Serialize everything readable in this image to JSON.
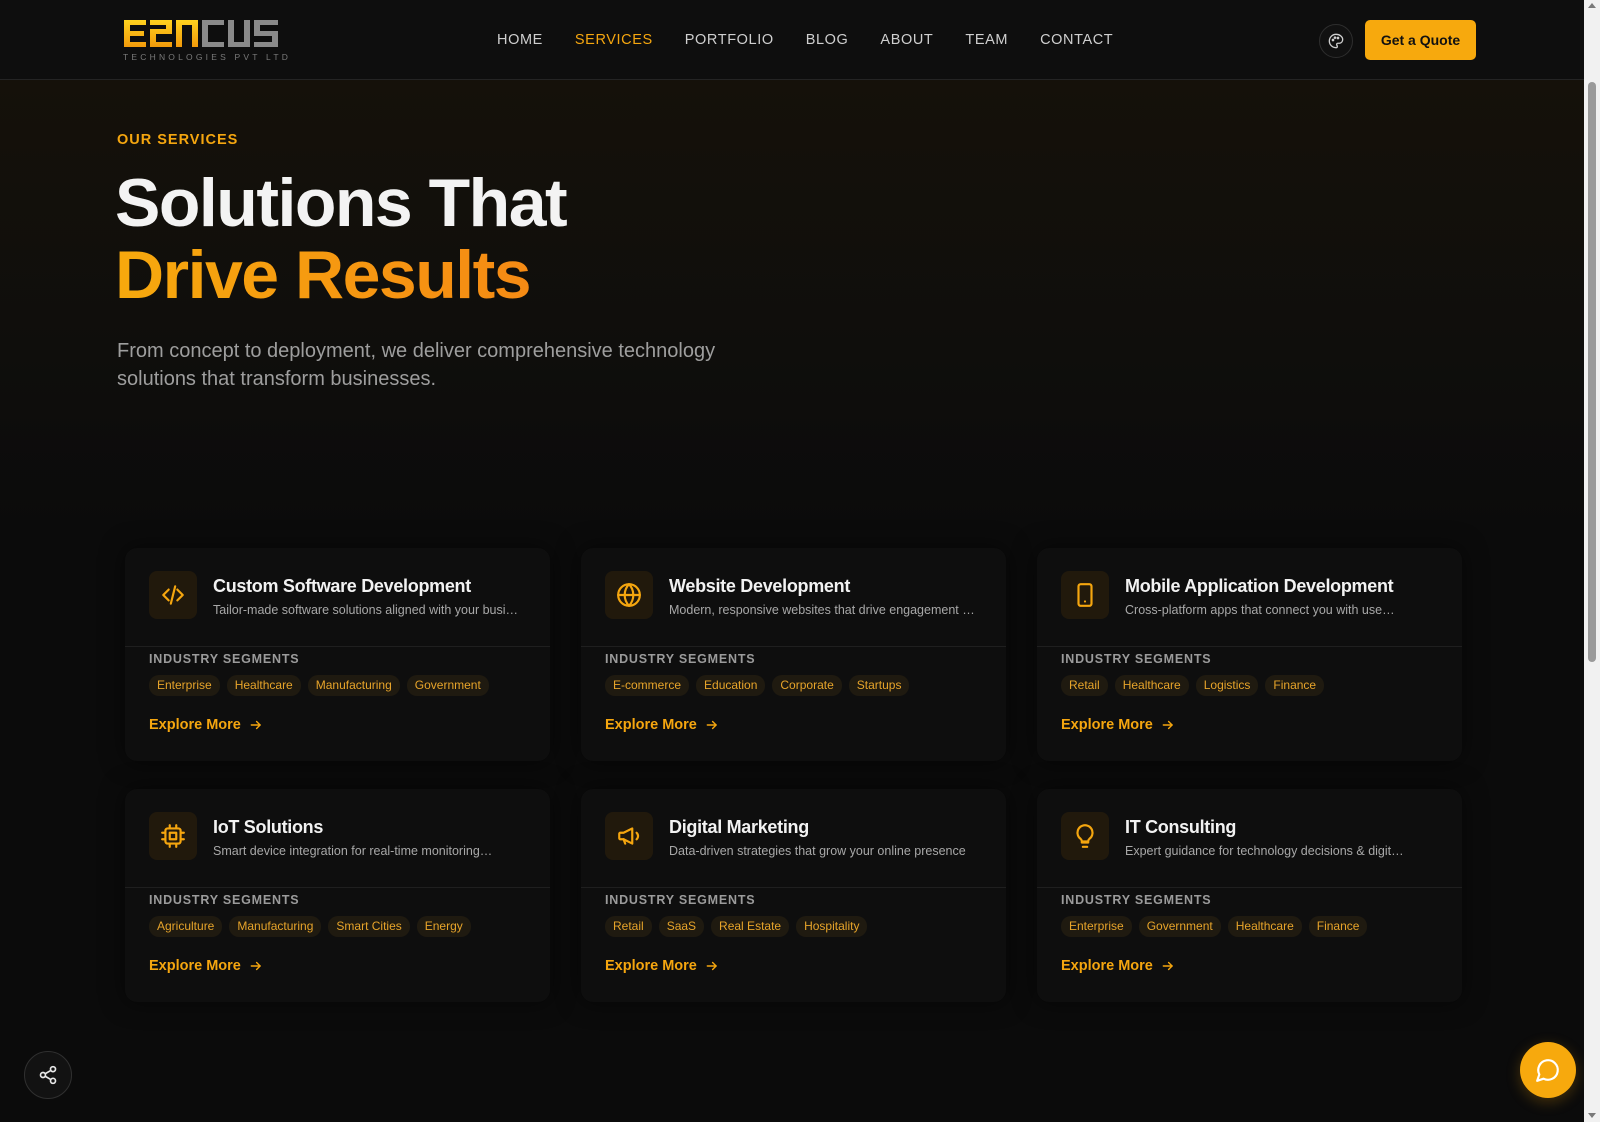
{
  "brand": {
    "logo_text": "E2NCUS",
    "logo_subtitle": "TECHNOLOGIES PVT LTD",
    "accent_color": "#f5a60f"
  },
  "nav": {
    "items": [
      {
        "label": "HOME",
        "active": false
      },
      {
        "label": "SERVICES",
        "active": true
      },
      {
        "label": "PORTFOLIO",
        "active": false
      },
      {
        "label": "BLOG",
        "active": false
      },
      {
        "label": "ABOUT",
        "active": false
      },
      {
        "label": "TEAM",
        "active": false
      },
      {
        "label": "CONTACT",
        "active": false
      }
    ],
    "theme_icon": "palette-icon",
    "cta_label": "Get a Quote"
  },
  "hero": {
    "eyebrow": "OUR SERVICES",
    "title_line1": "Solutions That",
    "title_line2": "Drive Results",
    "lead": "From concept to deployment, we deliver comprehensive technology solutions that transform businesses."
  },
  "services": [
    {
      "icon": "code-icon",
      "title": "Custom Software Development",
      "desc": "Tailor-made software solutions aligned with your business needs",
      "segments_label": "INDUSTRY SEGMENTS",
      "tags": [
        "Enterprise",
        "Healthcare",
        "Manufacturing",
        "Government"
      ],
      "cta": "Explore More"
    },
    {
      "icon": "globe-icon",
      "title": "Website Development",
      "desc": "Modern, responsive websites that drive engagement & conversions",
      "segments_label": "INDUSTRY SEGMENTS",
      "tags": [
        "E-commerce",
        "Education",
        "Corporate",
        "Startups"
      ],
      "cta": "Explore More"
    },
    {
      "icon": "smartphone-icon",
      "title": "Mobile Application Development",
      "desc": "Cross-platform apps that connect you with users anywhere",
      "segments_label": "INDUSTRY SEGMENTS",
      "tags": [
        "Retail",
        "Healthcare",
        "Logistics",
        "Finance"
      ],
      "cta": "Explore More"
    },
    {
      "icon": "cpu-icon",
      "title": "IoT Solutions",
      "desc": "Smart device integration for real-time monitoring & automation",
      "segments_label": "INDUSTRY SEGMENTS",
      "tags": [
        "Agriculture",
        "Manufacturing",
        "Smart Cities",
        "Energy"
      ],
      "cta": "Explore More"
    },
    {
      "icon": "megaphone-icon",
      "title": "Digital Marketing",
      "desc": "Data-driven strategies that grow your online presence",
      "segments_label": "INDUSTRY SEGMENTS",
      "tags": [
        "Retail",
        "SaaS",
        "Real Estate",
        "Hospitality"
      ],
      "cta": "Explore More"
    },
    {
      "icon": "lightbulb-icon",
      "title": "IT Consulting",
      "desc": "Expert guidance for technology decisions & digital transformation",
      "segments_label": "INDUSTRY SEGMENTS",
      "tags": [
        "Enterprise",
        "Government",
        "Healthcare",
        "Finance"
      ],
      "cta": "Explore More"
    }
  ],
  "floating": {
    "share_icon": "share-icon",
    "chat_icon": "chat-icon"
  }
}
